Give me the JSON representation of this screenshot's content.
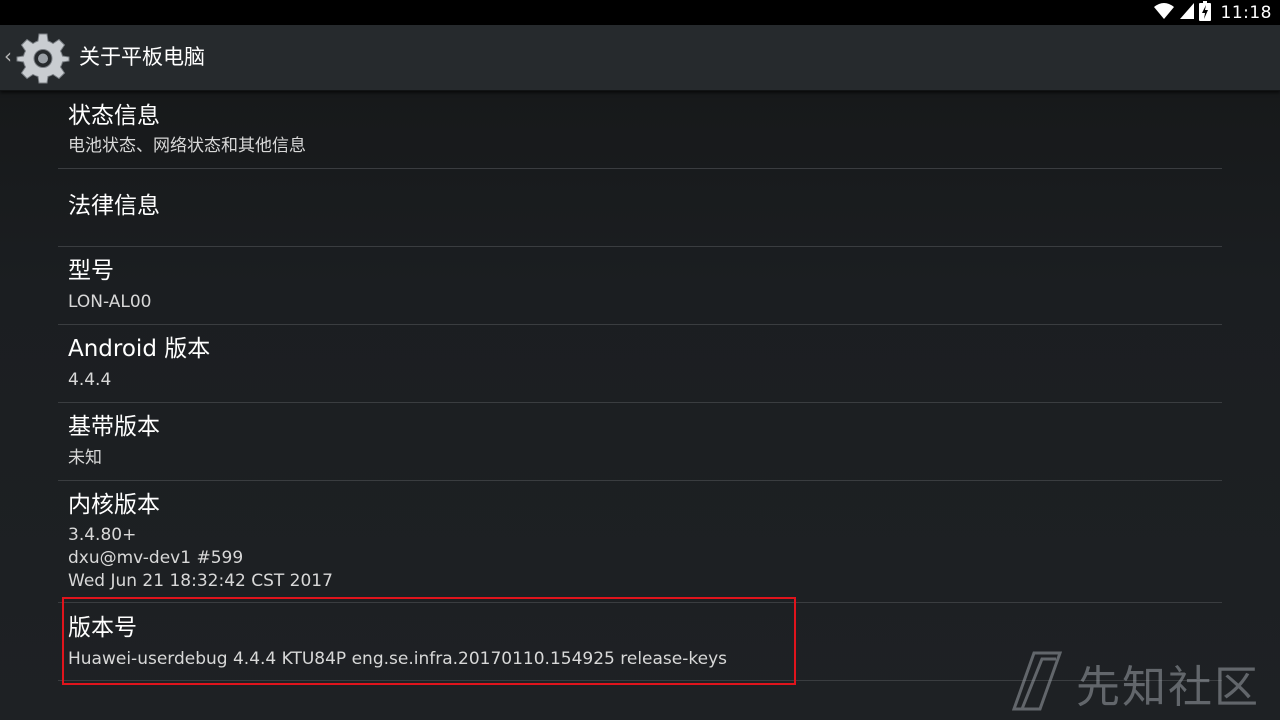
{
  "status_bar": {
    "time": "11:18",
    "icons": [
      "wifi-icon",
      "signal-icon",
      "battery-icon"
    ]
  },
  "action_bar": {
    "title": "关于平板电脑",
    "up_icon": "chevron-left-icon",
    "app_icon": "settings-gear-icon"
  },
  "items": [
    {
      "title": "状态信息",
      "summary": [
        "电池状态、网络状态和其他信息"
      ]
    },
    {
      "title": "法律信息",
      "summary": []
    },
    {
      "title": "型号",
      "summary": [
        "LON-AL00"
      ]
    },
    {
      "title": "Android 版本",
      "summary": [
        "4.4.4"
      ]
    },
    {
      "title": "基带版本",
      "summary": [
        "未知"
      ]
    },
    {
      "title": "内核版本",
      "summary": [
        "3.4.80+",
        "dxu@mv-dev1 #599",
        "Wed Jun 21 18:32:42 CST 2017"
      ]
    },
    {
      "title": "版本号",
      "summary": [
        "Huawei-userdebug 4.4.4 KTU84P eng.se.infra.20170110.154925 release-keys"
      ]
    }
  ],
  "watermark": {
    "text": "先知社区"
  },
  "colors": {
    "highlight": "#e0141c",
    "divider": "#3a3d40",
    "action_bar": "#262a2d",
    "background": "#1c1f23"
  }
}
